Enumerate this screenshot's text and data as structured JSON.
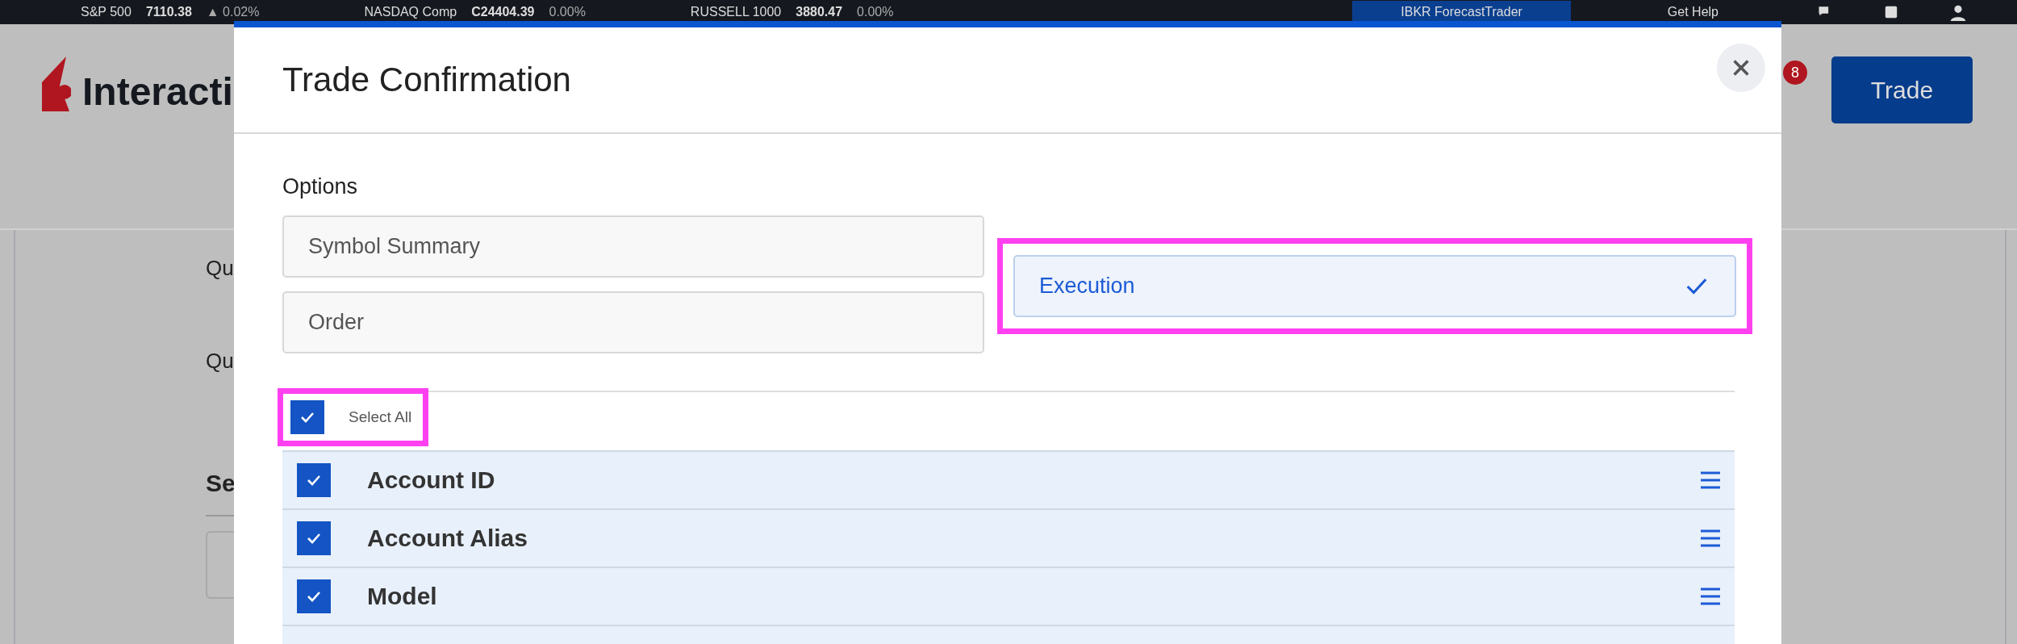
{
  "ticker": [
    {
      "name": "S&P 500",
      "value": "7110.38",
      "change": "▲ 0.02%"
    },
    {
      "name": "NASDAQ Comp",
      "value": "C24404.39",
      "change": "0.00%"
    },
    {
      "name": "RUSSELL 1000",
      "value": "3880.47",
      "change": "0.00%"
    }
  ],
  "top_nav": {
    "items": [
      {
        "label": "IBKR ForecastTrader",
        "selected": true
      },
      {
        "label": "Get Help",
        "selected": false
      }
    ]
  },
  "header": {
    "logo": "Interacti",
    "notifications_badge": "8",
    "trade_button": "Trade"
  },
  "page": {
    "labels": [
      "Qu",
      "Qu"
    ],
    "section_title": "Se"
  },
  "modal": {
    "title": "Trade Confirmation",
    "options_label": "Options",
    "options": [
      {
        "label": "Symbol Summary",
        "selected": false,
        "highlighted": false
      },
      {
        "label": "Order",
        "selected": false,
        "highlighted": false
      },
      {
        "label": "Execution",
        "selected": true,
        "highlighted": true
      }
    ],
    "select_all": {
      "label": "Select All",
      "checked": true,
      "highlighted": true
    },
    "fields": [
      {
        "label": "Account ID",
        "checked": true
      },
      {
        "label": "Account Alias",
        "checked": true
      },
      {
        "label": "Model",
        "checked": true
      }
    ]
  }
}
